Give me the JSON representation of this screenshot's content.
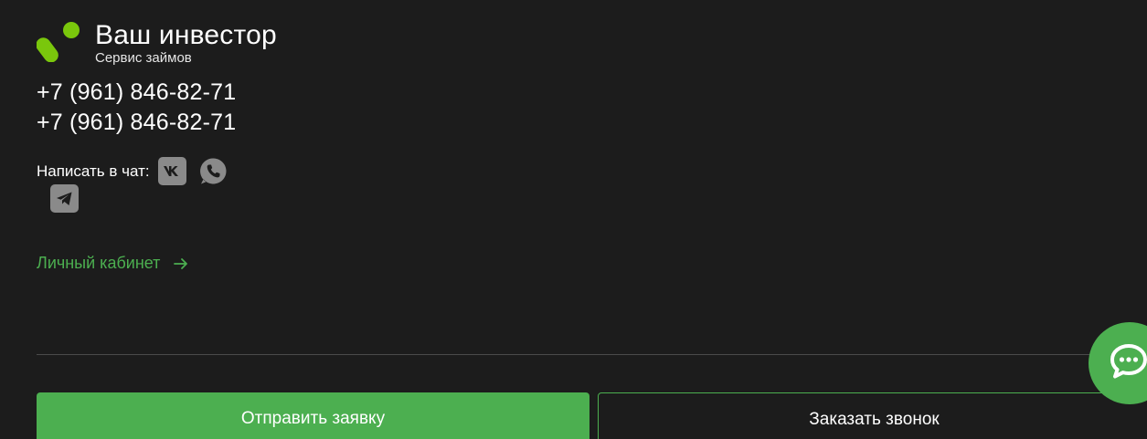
{
  "brand": {
    "title": "Ваш инвестор",
    "subtitle": "Сервис займов",
    "logo_icon": "brand-logo-icon",
    "accent_color": "#4caf50",
    "logo_color": "#7ac70c"
  },
  "contacts": {
    "phones": [
      "+7 (961) 846-82-71",
      "+7 (961) 846-82-71"
    ],
    "chat_label": "Написать в чат:",
    "messengers": [
      {
        "name": "vk",
        "icon": "vk-icon"
      },
      {
        "name": "whatsapp",
        "icon": "whatsapp-icon"
      },
      {
        "name": "telegram",
        "icon": "telegram-icon"
      }
    ]
  },
  "cabinet": {
    "label": "Личный кабинет",
    "icon": "arrow-right-icon"
  },
  "actions": {
    "submit_label": "Отправить заявку",
    "callback_label": "Заказать звонок"
  },
  "chat_widget": {
    "icon": "chat-bubble-icon"
  },
  "colors": {
    "background": "#1c1c1c",
    "icon_gray": "#8a8a8a",
    "divider": "#4a4a4a"
  }
}
